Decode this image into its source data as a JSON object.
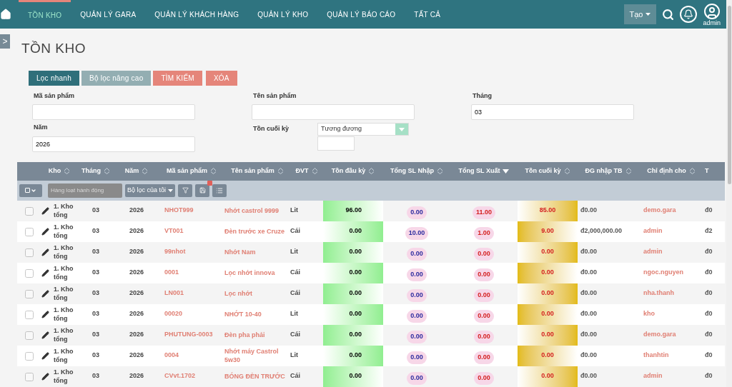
{
  "nav": {
    "items": [
      {
        "label": "TỒN KHO",
        "selected": true
      },
      {
        "label": "QUẢN LÝ GARA",
        "selected": false
      },
      {
        "label": "QUẢN LÝ KHÁCH HÀNG",
        "selected": false
      },
      {
        "label": "QUẢN LÝ KHO",
        "selected": false
      },
      {
        "label": "QUẢN LÝ BÁO CÁO",
        "selected": false
      },
      {
        "label": "TẤT CẢ",
        "selected": false
      }
    ],
    "create_button": "Tạo",
    "user": "admin"
  },
  "sidebar_toggle": ">",
  "page_title": "TỒN KHO",
  "filter_tabs": [
    {
      "label": "Lọc nhanh",
      "kind": "primary"
    },
    {
      "label": "Bộ lọc nâng cao",
      "kind": "secondary"
    },
    {
      "label": "TÌM KIẾM",
      "kind": "danger"
    },
    {
      "label": "XÓA",
      "kind": "danger"
    }
  ],
  "filters": [
    {
      "label": "Mã sản phẩm"
    },
    {
      "label": "Tên sản phẩm"
    },
    {
      "label": "Tháng",
      "value": "03"
    },
    {
      "label": "Năm",
      "value": "2026"
    }
  ],
  "ending_stock_filter": {
    "label": "Tồn cuối kỳ",
    "operator": "Tương đương"
  },
  "table": {
    "columns": [
      {
        "label": "Kho",
        "sorted": false
      },
      {
        "label": "Tháng",
        "sorted": false
      },
      {
        "label": "Năm",
        "sorted": false
      },
      {
        "label": "Mã sản phẩm",
        "sorted": false
      },
      {
        "label": "Tên sản phẩm",
        "sorted": false
      },
      {
        "label": "ĐVT",
        "sorted": false
      },
      {
        "label": "Tồn đầu kỳ",
        "sorted": false
      },
      {
        "label": "Tổng SL Nhập",
        "sorted": false
      },
      {
        "label": "Tổng SL Xuất",
        "sorted": true
      },
      {
        "label": "Tồn cuối kỳ",
        "sorted": false
      },
      {
        "label": "ĐG nhập TB",
        "sorted": false
      },
      {
        "label": "Chỉ định cho",
        "sorted": false
      },
      {
        "label": "T"
      }
    ],
    "toolbar": {
      "bulk_action": "Hàng loạt hành động",
      "my_filter": "Bộ lọc của tôi"
    },
    "rows": [
      {
        "checked": false,
        "kho": "1. Kho tổng",
        "month": "03",
        "year": "2026",
        "code": "NHOT999",
        "name": "Nhớt castrol 9999",
        "unit": "Lit",
        "opening": "96.00",
        "in": "0.00",
        "out": "11.00",
        "closing": "85.00",
        "avg_price": "đ0.00",
        "assigned": "demo.gara",
        "column_13": "đ0"
      },
      {
        "checked": false,
        "kho": "1. Kho tổng",
        "month": "03",
        "year": "2026",
        "code": "VT001",
        "name": "Đèn trước xe Cruze",
        "unit": "Cái",
        "opening": "0.00",
        "in": "10.00",
        "out": "1.00",
        "closing": "9.00",
        "avg_price": "đ2,000,000.00",
        "assigned": "admin",
        "column_13": "đ2"
      },
      {
        "checked": false,
        "kho": "1. Kho tổng",
        "month": "03",
        "year": "2026",
        "code": "99nhot",
        "name": "Nhớt Nam",
        "unit": "Lit",
        "opening": "0.00",
        "in": "0.00",
        "out": "0.00",
        "closing": "0.00",
        "avg_price": "đ0.00",
        "assigned": "admin",
        "column_13": "đ0"
      },
      {
        "checked": false,
        "kho": "1. Kho tổng",
        "month": "03",
        "year": "2026",
        "code": "0001",
        "name": "Lọc nhớt innova",
        "unit": "Cái",
        "opening": "0.00",
        "in": "0.00",
        "out": "0.00",
        "closing": "0.00",
        "avg_price": "đ0.00",
        "assigned": "ngoc.nguyen",
        "column_13": "đ0"
      },
      {
        "checked": false,
        "kho": "1. Kho tổng",
        "month": "03",
        "year": "2026",
        "code": "LN001",
        "name": "Lọc nhớt",
        "unit": "Cái",
        "opening": "0.00",
        "in": "0.00",
        "out": "0.00",
        "closing": "0.00",
        "avg_price": "đ0.00",
        "assigned": "nha.thanh",
        "column_13": "đ0"
      },
      {
        "checked": false,
        "kho": "1. Kho tổng",
        "month": "03",
        "year": "2026",
        "code": "00020",
        "name": "NHỚT 10-40",
        "unit": "Lit",
        "opening": "0.00",
        "in": "0.00",
        "out": "0.00",
        "closing": "0.00",
        "avg_price": "đ0.00",
        "assigned": "kho",
        "column_13": "đ0"
      },
      {
        "checked": false,
        "kho": "1. Kho tổng",
        "month": "03",
        "year": "2026",
        "code": "PHUTUNG-0003",
        "name": "Đèn pha phải",
        "unit": "Cái",
        "opening": "0.00",
        "in": "0.00",
        "out": "0.00",
        "closing": "0.00",
        "avg_price": "đ0.00",
        "assigned": "demo.gara",
        "column_13": "đ0"
      },
      {
        "checked": false,
        "kho": "1. Kho tổng",
        "month": "03",
        "year": "2026",
        "code": "0004",
        "name": "Nhớt máy Castrol 5w30",
        "unit": "Lit",
        "opening": "0.00",
        "in": "0.00",
        "out": "0.00",
        "closing": "0.00",
        "avg_price": "đ0.00",
        "assigned": "thanhtin",
        "column_13": "đ0"
      },
      {
        "checked": false,
        "kho": "1. Kho tổng",
        "month": "03",
        "year": "2026",
        "code": "CVvt.1702",
        "name": "BÓNG ĐÈN TRƯỚC",
        "unit": "Cái",
        "opening": "0.00",
        "in": "0.00",
        "out": "0.00",
        "closing": "0.00",
        "avg_price": "đ0.00",
        "assigned": "admin",
        "column_13": "đ0"
      }
    ]
  }
}
